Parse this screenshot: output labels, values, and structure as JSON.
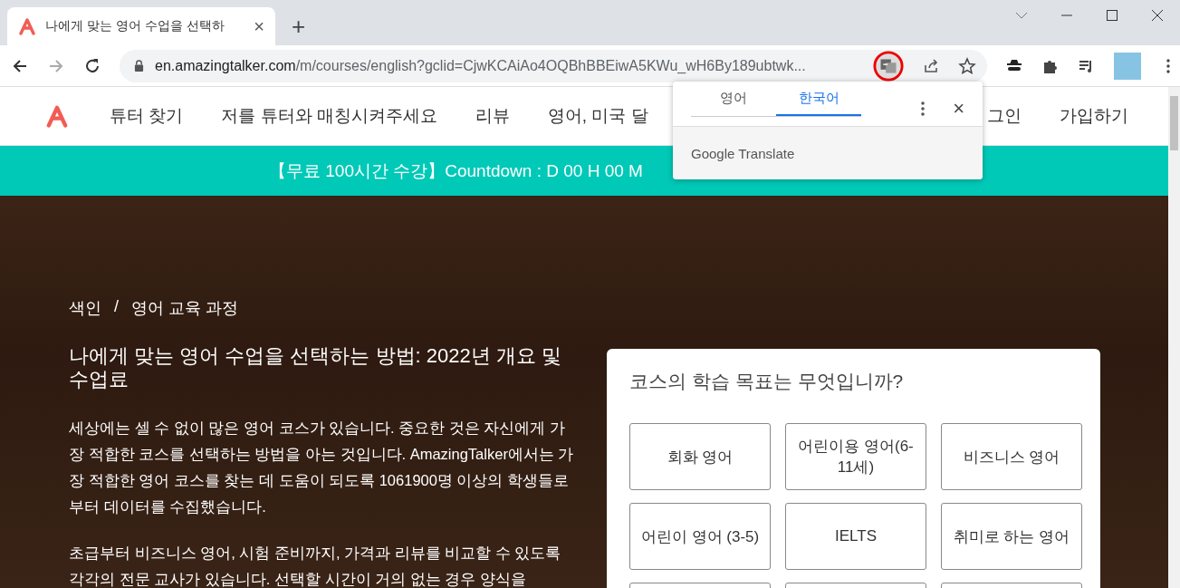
{
  "browser": {
    "tab": {
      "title": "나에게 맞는 영어 수업을 선택하",
      "close": "×"
    },
    "new_tab": "+",
    "url": {
      "host": "en.amazingtalker.com",
      "path": "/m/courses/english?gclid=CjwKCAiAo4OQBhBBEiwA5KWu_wH6By189ubtwk..."
    }
  },
  "page": {
    "nav": [
      "튜터 찾기",
      "저를 튜터와 매칭시켜주세요",
      "리뷰",
      "영어, 미국 달"
    ],
    "nav_right": [
      "그인",
      "가입하기"
    ],
    "banner": "【무료 100시간 수강】Countdown : D 00 H 00 M",
    "breadcrumb": [
      "색인",
      "영어 교육 과정"
    ],
    "breadcrumb_separator": "/",
    "heading": "나에게 맞는 영어 수업을 선택하는 방법: 2022년 개요 및 수업료",
    "paragraphs": [
      "세상에는 셀 수 없이 많은 영어 코스가 있습니다. 중요한 것은 자신에게 가장 적합한 코스를 선택하는 방법을 아는 것입니다. AmazingTalker에서는 가장 적합한 영어 코스를 찾는 데 도움이 되도록 1061900명 이상의 학생들로부터 데이터를 수집했습니다.",
      "초급부터 비즈니스 영어, 시험 준비까지, 가격과 리뷰를 비교할 수 있도록 각각의 전문 교사가 있습니다. 선택할 시간이 거의 없는 경우 양식을"
    ],
    "goal_card": {
      "title": "코스의 학습 목표는 무엇입니까?",
      "options": [
        {
          "kind": "text",
          "label": "회화 영어"
        },
        {
          "kind": "text",
          "label": "어린이용 영어(6-11세)"
        },
        {
          "kind": "text",
          "label": "비즈니스 영어"
        },
        {
          "kind": "text",
          "label": "어린이 영어 (3-5)"
        },
        {
          "kind": "text",
          "label": "IELTS"
        },
        {
          "kind": "text",
          "label": "취미로 하는 영어"
        },
        {
          "kind": "cut"
        },
        {
          "kind": "cut"
        },
        {
          "kind": "cut"
        }
      ]
    }
  },
  "translate_popup": {
    "tabs": [
      {
        "label": "영어",
        "selected": false
      },
      {
        "label": "한국어",
        "selected": true
      }
    ],
    "close": "×",
    "brand": "Google Translate"
  }
}
